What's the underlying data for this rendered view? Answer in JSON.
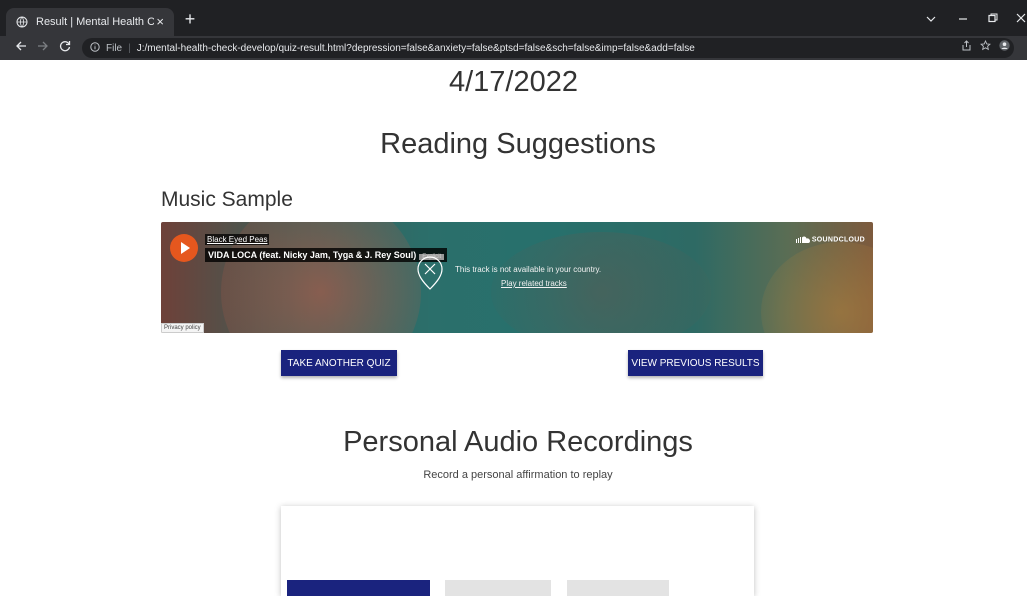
{
  "browser": {
    "tab_title": "Result | Mental Health Check",
    "tab_close": "×",
    "new_tab": "+",
    "url_label": "File",
    "url": "J:/mental-health-check-develop/quiz-result.html?depression=false&anxiety=false&ptsd=false&sch=false&imp=false&add=false"
  },
  "page": {
    "date": "4/17/2022",
    "reading_heading": "Reading Suggestions",
    "music_heading": "Music Sample",
    "player": {
      "artist": "Black Eyed Peas",
      "track": "VIDA LOCA (feat. Nicky Jam, Tyga & J. Rey Soul)",
      "badge": "Explicit",
      "brand": "SOUNDCLOUD",
      "unavailable": "This track is not available in your country.",
      "related": "Play related tracks",
      "privacy": "Privacy policy"
    },
    "take_quiz_button": "TAKE ANOTHER QUIZ",
    "view_results_button": "VIEW PREVIOUS RESULTS",
    "recordings_heading": "Personal Audio Recordings",
    "recordings_sub": "Record a personal affirmation to replay"
  },
  "colors": {
    "primary_button": "#1a237e",
    "soundcloud_orange": "#e5571e"
  }
}
